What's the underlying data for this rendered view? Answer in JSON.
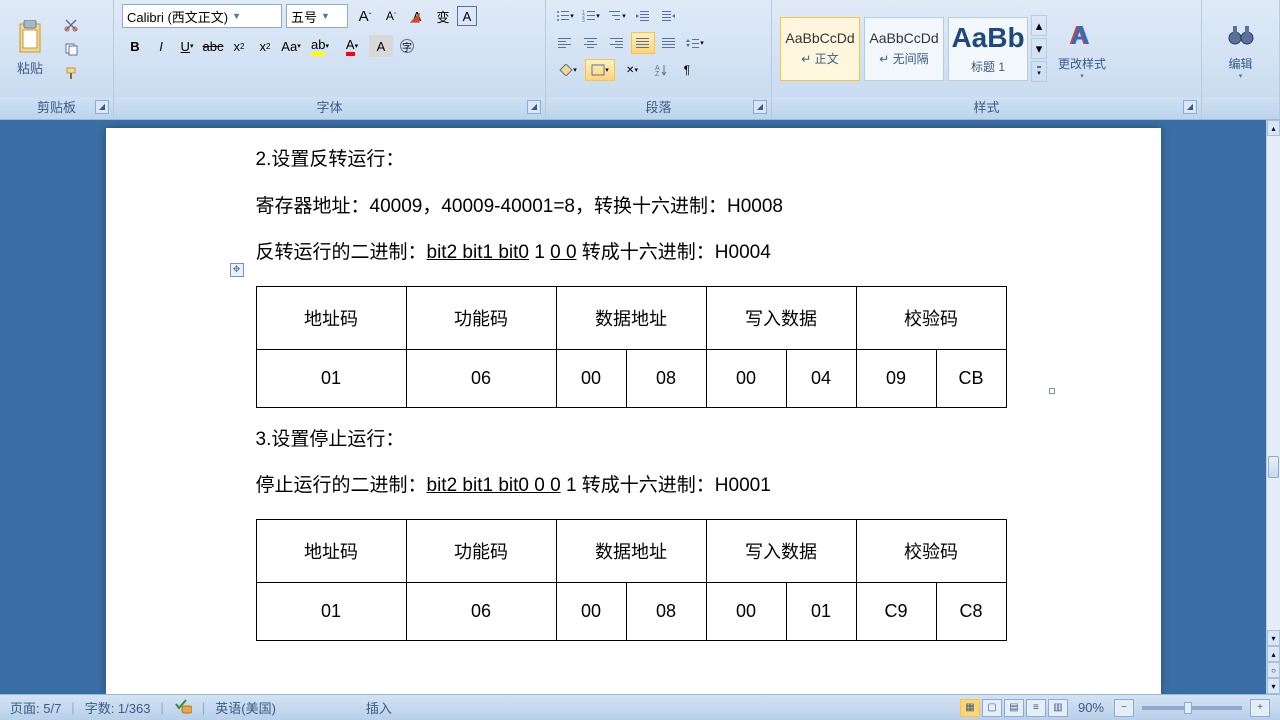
{
  "ribbon": {
    "clipboard": {
      "paste": "粘贴",
      "label": "剪贴板"
    },
    "font": {
      "family": "Calibri (西文正文)",
      "size": "五号",
      "label": "字体"
    },
    "paragraph": {
      "label": "段落"
    },
    "styles": {
      "label": "样式",
      "style1_sample": "AaBbCcDd",
      "style1_name": "↵ 正文",
      "style2_sample": "AaBbCcDd",
      "style2_name": "↵ 无间隔",
      "style3_sample": "AaBb",
      "style3_name": "标题 1",
      "change": "更改样式"
    },
    "editing": {
      "label": "编辑"
    }
  },
  "document": {
    "p1": "2.设置反转运行：",
    "p2": "寄存器地址：40009，40009-40001=8，转换十六进制：H0008",
    "p3a": "反转运行的二进制：",
    "p3b": "bit2 bit1 bit0",
    "p3c": "   1     ",
    "p3d": "0    0",
    "p3e": "    转成十六进制：H0004",
    "table1": {
      "h1": "地址码",
      "h2": "功能码",
      "h3": "数据地址",
      "h4": "写入数据",
      "h5": "校验码",
      "c1": "01",
      "c2": "06",
      "c3": "00",
      "c4": "08",
      "c5": "00",
      "c6": "04",
      "c7": "09",
      "c8": "CB"
    },
    "p4": "3.设置停止运行：",
    "p5a": "停止运行的二进制：",
    "p5b": "bit2 bit1 bit0    0    0",
    "p5c": "    1   转成十六进制：H0001",
    "table2": {
      "h1": "地址码",
      "h2": "功能码",
      "h3": "数据地址",
      "h4": "写入数据",
      "h5": "校验码",
      "c1": "01",
      "c2": "06",
      "c3": "00",
      "c4": "08",
      "c5": "00",
      "c6": "01",
      "c7": "C9",
      "c8": "C8"
    }
  },
  "status": {
    "page": "页面: 5/7",
    "words": "字数: 1/363",
    "lang": "英语(美国)",
    "mode": "插入",
    "zoom": "90%"
  },
  "colors": {
    "accent": "#f9c73d",
    "ribbon_bg": "#c5d9f0"
  }
}
